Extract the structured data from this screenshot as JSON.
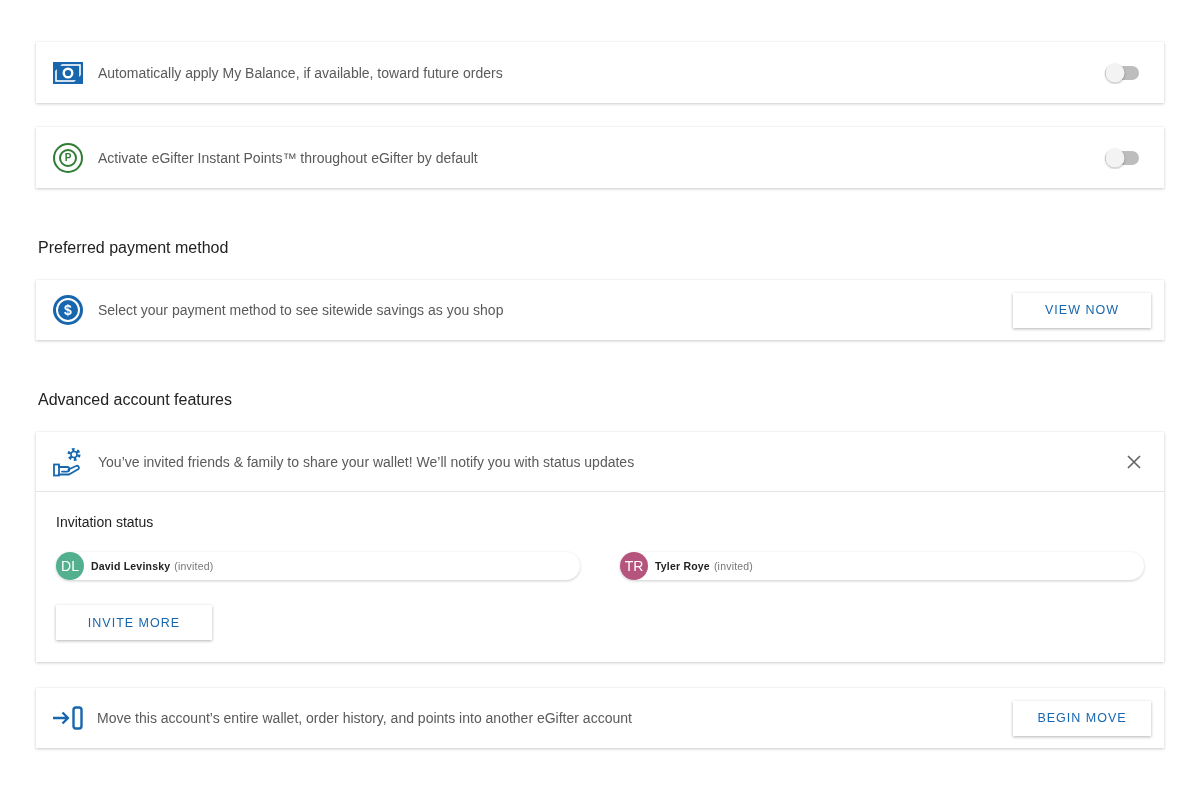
{
  "toggle_settings": [
    {
      "text": "Automatically apply My Balance, if available, toward future orders",
      "on": false
    },
    {
      "icon_text": "P",
      "text": "Activate eGifter Instant Points™ throughout eGifter by default",
      "on": false
    }
  ],
  "payment_section": {
    "heading": "Preferred payment method",
    "icon_text": "$",
    "text": "Select your payment method to see sitewide savings as you shop",
    "button": "VIEW NOW"
  },
  "advanced_section": {
    "heading": "Advanced account features",
    "invite_panel": {
      "text": "You’ve invited friends & family to share your wallet! We’ll notify you with status updates",
      "status_heading": "Invitation status",
      "invitees": [
        {
          "initials": "DL",
          "name": "David Levinsky",
          "status": "(invited)",
          "color": "#52b08f"
        },
        {
          "initials": "TR",
          "name": "Tyler Roye",
          "status": "(invited)",
          "color": "#b5557e"
        }
      ],
      "button": "INVITE MORE"
    },
    "move_card": {
      "text": "Move this account’s entire wallet, order history, and points into another eGifter account",
      "button": "BEGIN MOVE"
    }
  }
}
